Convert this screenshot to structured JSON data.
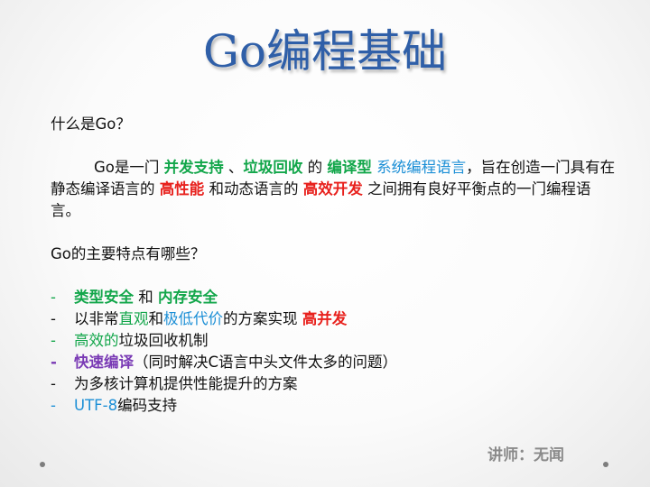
{
  "slide": {
    "title": "Go编程基础",
    "question1": "什么是Go？",
    "para": {
      "t1": "Go是一门 ",
      "h1": "并发支持",
      "t2": " 、",
      "h2": "垃圾回收",
      "t3": " 的 ",
      "h3": "编译型",
      "t4": " ",
      "h4": "系统编程语言",
      "t5": "，旨在创造一门具有在静态编译语言的 ",
      "h5": "高性能",
      "t6": " 和动态语言的 ",
      "h6": "高效开发",
      "t7": " 之间拥有良好平衡点的一门编程语言。"
    },
    "question2": "Go的主要特点有哪些？",
    "bullets": {
      "dash": "-",
      "b1a": "类型安全",
      "b1b": " 和 ",
      "b1c": "内存安全",
      "b2a": "以非常",
      "b2b": "直观",
      "b2c": "和",
      "b2d": "极低代价",
      "b2e": "的方案实现 ",
      "b2f": "高并发",
      "b3a": "高效的",
      "b3b": "垃圾回收机制",
      "b4a": "快速编译",
      "b4b": "（同时解决C语言中头文件太多的问题）",
      "b5": "为多核计算机提供性能提升的方案",
      "b6a": "UTF-8",
      "b6b": "编码支持"
    },
    "author": "讲师：无闻"
  },
  "colors": {
    "title": "#2f5fa8",
    "green": "#12a64a",
    "red": "#e8211d",
    "blue": "#1c8fd6",
    "purple": "#7a3bb5",
    "author": "#8a8a8a"
  }
}
